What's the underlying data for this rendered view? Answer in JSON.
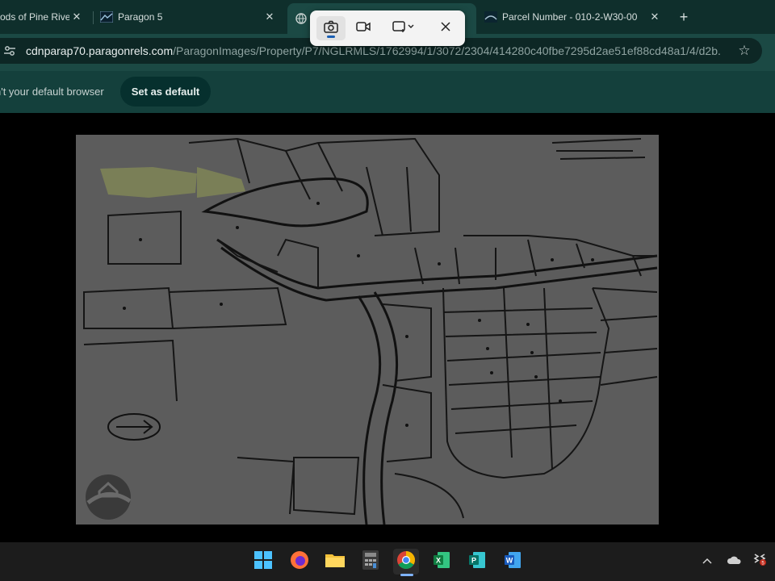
{
  "tabs": [
    {
      "title": "ods of Pine Rive",
      "close": "✕"
    },
    {
      "title": "Paragon 5",
      "close": "✕"
    },
    {
      "title": "",
      "close": ""
    },
    {
      "title": "Parcel Number - 010-2-W30-00",
      "close": "✕"
    }
  ],
  "new_tab_label": "+",
  "address": {
    "host": "cdnparap70.paragonrels.com",
    "path": "/ParagonImages/Property/P7/NGLRMLS/1762994/1/3072/2304/414280c40fbe7295d2ae51ef88cd48a1/4/d2b..."
  },
  "infobar": {
    "message": "n't your default browser",
    "button_label": "Set as default"
  },
  "snipping_toolbar": {
    "modes": [
      "screenshot",
      "video"
    ],
    "selected": "screenshot",
    "shape_menu": "rectangle"
  },
  "taskbar": {
    "apps": [
      "start",
      "firefox",
      "file-explorer",
      "calculator",
      "chrome",
      "excel",
      "publisher",
      "word"
    ],
    "active_app": "chrome",
    "tray_badge": "5"
  },
  "colors": {
    "chrome_dark": "#0f2f2c",
    "accent": "#1a5fb4",
    "highlight_parcel": "#8a8f5f"
  }
}
